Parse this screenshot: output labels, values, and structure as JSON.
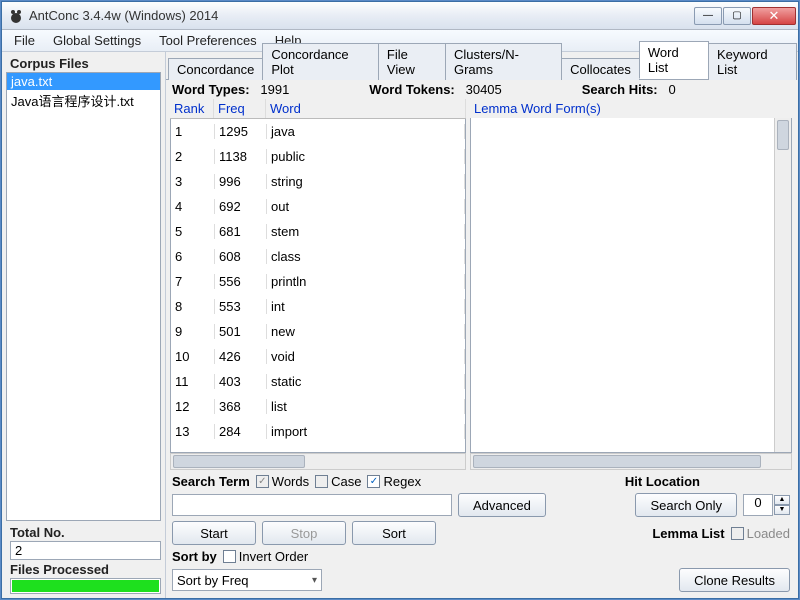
{
  "window": {
    "title": "AntConc 3.4.4w (Windows) 2014"
  },
  "menu": [
    "File",
    "Global Settings",
    "Tool Preferences",
    "Help"
  ],
  "leftpane": {
    "corpus_label": "Corpus Files",
    "files": [
      "java.txt",
      "Java语言程序设计.txt"
    ],
    "selected_index": 0,
    "total_label": "Total No.",
    "total_value": "2",
    "processed_label": "Files Processed"
  },
  "tabs": [
    "Concordance",
    "Concordance Plot",
    "File View",
    "Clusters/N-Grams",
    "Collocates",
    "Word List",
    "Keyword List"
  ],
  "active_tab_index": 5,
  "stats": {
    "types_label": "Word Types:",
    "types_value": "1991",
    "tokens_label": "Word Tokens:",
    "tokens_value": "30405",
    "hits_label": "Search Hits:",
    "hits_value": "0"
  },
  "table": {
    "cols": {
      "rank": "Rank",
      "freq": "Freq",
      "word": "Word"
    },
    "rows": [
      {
        "rank": "1",
        "freq": "1295",
        "word": "java"
      },
      {
        "rank": "2",
        "freq": "1138",
        "word": "public"
      },
      {
        "rank": "3",
        "freq": "996",
        "word": "string"
      },
      {
        "rank": "4",
        "freq": "692",
        "word": "out"
      },
      {
        "rank": "5",
        "freq": "681",
        "word": "stem"
      },
      {
        "rank": "6",
        "freq": "608",
        "word": "class"
      },
      {
        "rank": "7",
        "freq": "556",
        "word": "println"
      },
      {
        "rank": "8",
        "freq": "553",
        "word": "int"
      },
      {
        "rank": "9",
        "freq": "501",
        "word": "new"
      },
      {
        "rank": "10",
        "freq": "426",
        "word": "void"
      },
      {
        "rank": "11",
        "freq": "403",
        "word": "static"
      },
      {
        "rank": "12",
        "freq": "368",
        "word": "list"
      },
      {
        "rank": "13",
        "freq": "284",
        "word": "import"
      }
    ]
  },
  "lemma": {
    "header": "Lemma Word Form(s)"
  },
  "controls": {
    "search_term_label": "Search Term",
    "words_label": "Words",
    "case_label": "Case",
    "regex_label": "Regex",
    "advanced_label": "Advanced",
    "hit_location_label": "Hit Location",
    "search_only_label": "Search Only",
    "hit_value": "0",
    "start_label": "Start",
    "stop_label": "Stop",
    "sort_label": "Sort",
    "lemma_list_label": "Lemma List",
    "loaded_label": "Loaded",
    "sort_by_label": "Sort by",
    "invert_label": "Invert Order",
    "sort_option": "Sort by Freq",
    "clone_label": "Clone Results"
  }
}
